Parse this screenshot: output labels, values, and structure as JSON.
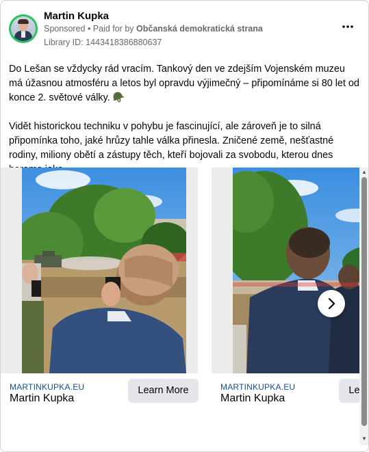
{
  "ad": {
    "advertiser_name": "Martin Kupka",
    "sponsored_label": "Sponsored",
    "separator": " • ",
    "paid_for_by_label": "Paid for by ",
    "paid_for_by_entity": "Občanská demokratická strana",
    "library_id": "Library ID: 1443418386880637",
    "more_options_icon": "more-horizontal-icon",
    "brand_ring_color": "#22c55e"
  },
  "post": {
    "paragraph_1": "Do Lešan se vždycky rád vracím. Tankový den ve zdejším Vojenském muzeu má úžasnou atmosféru a letos byl opravdu výjimečný – připomínáme si 80 let od konce 2. světové války. 🪖",
    "paragraph_2": "Vidět historickou techniku v pohybu je fascinující, ale zároveň je to silná připomínka toho, jaké hrůzy tahle válka přinesla. Zničené země, nešťastné rodiny, miliony obětí a zástupy těch, kteří bojovali za svobodu, kterou dnes bereme jako…"
  },
  "carousel": {
    "cards": [
      {
        "domain": "MARTINKUPKA.EU",
        "title": "Martin Kupka",
        "cta_label": "Learn More"
      },
      {
        "domain": "MARTINKUPKA.EU",
        "title": "Martin Kupka",
        "cta_label": "Learn More"
      }
    ],
    "next_icon": "chevron-right-icon",
    "link_color": "#0f4d92",
    "cta_bg_color": "#e4e6eb"
  }
}
